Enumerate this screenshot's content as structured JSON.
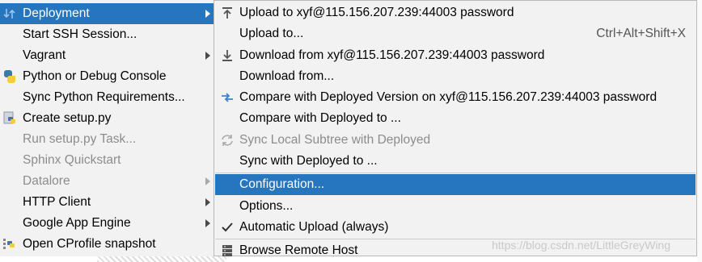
{
  "left_menu": {
    "items": [
      {
        "label": "Deployment",
        "icon": "deployment-icon",
        "submenu": true,
        "selected": true,
        "disabled": false
      },
      {
        "label": "Start SSH Session...",
        "icon": "",
        "submenu": false,
        "selected": false,
        "disabled": false
      },
      {
        "label": "Vagrant",
        "icon": "",
        "submenu": true,
        "selected": false,
        "disabled": false
      },
      {
        "label": "Python or Debug Console",
        "icon": "python-icon",
        "submenu": false,
        "selected": false,
        "disabled": false
      },
      {
        "label": "Sync Python Requirements...",
        "icon": "",
        "submenu": false,
        "selected": false,
        "disabled": false
      },
      {
        "label": "Create setup.py",
        "icon": "python-file-icon",
        "submenu": false,
        "selected": false,
        "disabled": false
      },
      {
        "label": "Run setup.py Task...",
        "icon": "",
        "submenu": false,
        "selected": false,
        "disabled": true
      },
      {
        "label": "Sphinx Quickstart",
        "icon": "",
        "submenu": false,
        "selected": false,
        "disabled": true
      },
      {
        "label": "Datalore",
        "icon": "",
        "submenu": true,
        "selected": false,
        "disabled": true
      },
      {
        "label": "HTTP Client",
        "icon": "",
        "submenu": true,
        "selected": false,
        "disabled": false
      },
      {
        "label": "Google App Engine",
        "icon": "",
        "submenu": true,
        "selected": false,
        "disabled": false
      },
      {
        "label": "Open CProfile snapshot",
        "icon": "python-profile-icon",
        "submenu": false,
        "selected": false,
        "disabled": false
      }
    ]
  },
  "deployment_submenu": {
    "items": [
      {
        "label": "Upload to xyf@115.156.207.239:44003 password",
        "icon": "upload-icon",
        "shortcut": ""
      },
      {
        "label": "Upload to...",
        "icon": "",
        "shortcut": "Ctrl+Alt+Shift+X"
      },
      {
        "label": "Download from xyf@115.156.207.239:44003 password",
        "icon": "download-icon",
        "shortcut": ""
      },
      {
        "label": "Download from...",
        "icon": "",
        "shortcut": ""
      },
      {
        "label": "Compare with Deployed Version on xyf@115.156.207.239:44003 password",
        "icon": "compare-icon",
        "shortcut": ""
      },
      {
        "label": "Compare with Deployed to ...",
        "icon": "",
        "shortcut": ""
      },
      {
        "label": "Sync Local Subtree with Deployed",
        "icon": "sync-icon",
        "shortcut": "",
        "disabled": true
      },
      {
        "label": "Sync with Deployed to ...",
        "icon": "",
        "shortcut": ""
      },
      {
        "label": "Configuration...",
        "icon": "",
        "shortcut": "",
        "selected": true
      },
      {
        "label": "Options...",
        "icon": "",
        "shortcut": ""
      },
      {
        "label": "Automatic Upload (always)",
        "icon": "checkmark-icon",
        "shortcut": "",
        "checked": true
      },
      {
        "label": "Browse Remote Host",
        "icon": "remote-host-icon",
        "shortcut": ""
      }
    ]
  },
  "watermark": "https://blog.csdn.net/LittleGreyWing",
  "colors": {
    "selection": "#2675bf",
    "menu_bg": "#f2f2f2",
    "disabled_text": "#8c8c8c"
  }
}
